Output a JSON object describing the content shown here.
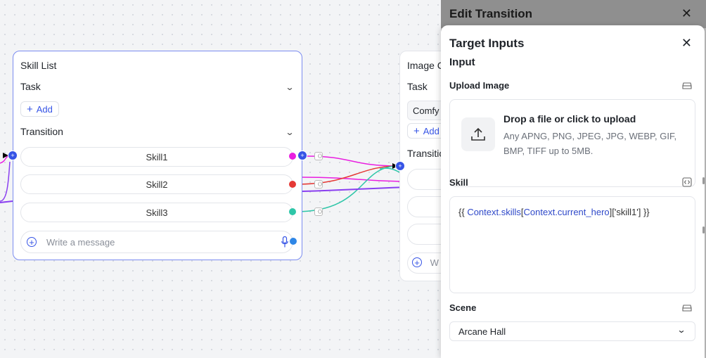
{
  "skill_node": {
    "title": "Skill List",
    "task_label": "Task",
    "add_label": "Add",
    "transition_label": "Transition",
    "skills": [
      {
        "label": "Skill1",
        "port_color": "#e91ee0"
      },
      {
        "label": "Skill2",
        "port_color": "#e53935"
      },
      {
        "label": "Skill3",
        "port_color": "#2ec6a8"
      }
    ],
    "message_placeholder": "Write a message"
  },
  "image_node": {
    "title": "Image C",
    "task_label": "Task",
    "input_value": "Comfy",
    "add_label": "Add",
    "transition_label": "Transitio",
    "message_partial": "W"
  },
  "panel": {
    "header_title": "Edit Transition",
    "title": "Target Inputs",
    "subtitle": "Input",
    "upload": {
      "label": "Upload Image",
      "title": "Drop a file or click to upload",
      "description": "Any APNG, PNG, JPEG, JPG, WEBP, GIF, BMP, TIFF up to 5MB."
    },
    "skill": {
      "label": "Skill",
      "open": "{{",
      "var1": "Context.skills",
      "bracket_open": "[",
      "var2": "Context.current_hero",
      "tail": "]['skill1'] }}"
    },
    "scene": {
      "label": "Scene",
      "value": "Arcane Hall"
    }
  },
  "colors": {
    "accent": "#3654e6",
    "edge_magenta": "#e91ee0",
    "edge_red": "#e53935",
    "edge_teal": "#2ec6a8",
    "edge_purple": "#8a3ff0"
  }
}
